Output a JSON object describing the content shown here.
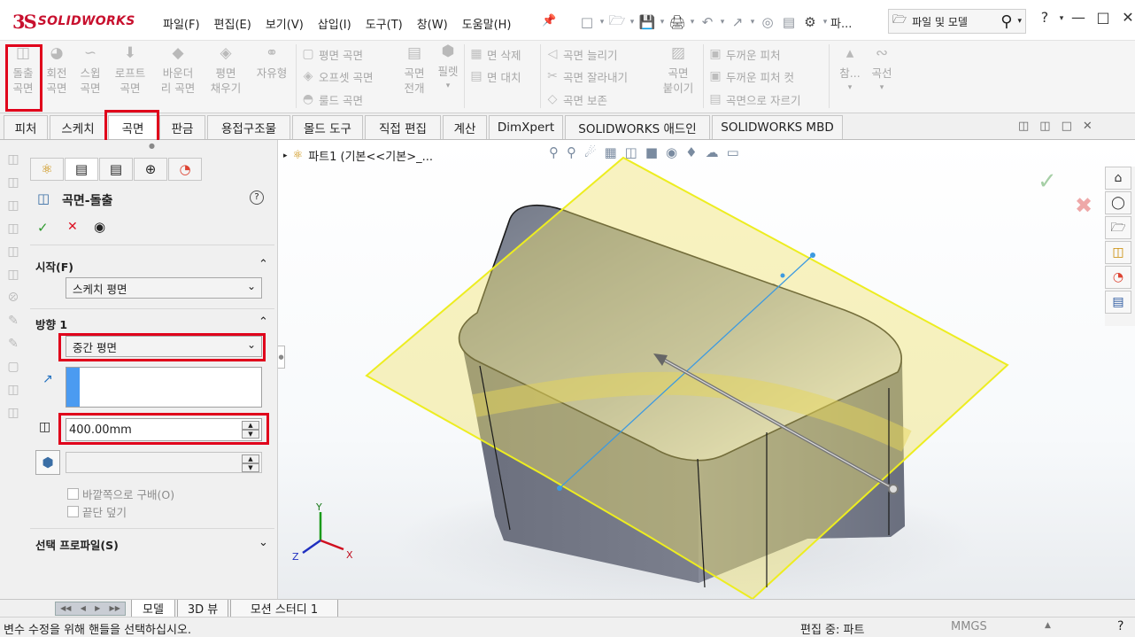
{
  "app": {
    "logo_ds": "3S",
    "logo_name": "SOLIDWORKS"
  },
  "menu": [
    "파일(F)",
    "편집(E)",
    "보기(V)",
    "삽입(I)",
    "도구(T)",
    "창(W)",
    "도움말(H)"
  ],
  "quick_access": {
    "more_label": "파...",
    "search_placeholder": "파일 및 모델"
  },
  "ribbon": {
    "large_buttons": [
      {
        "line1": "돌출",
        "line2": "곡면"
      },
      {
        "line1": "회전",
        "line2": "곡면"
      },
      {
        "line1": "스윕",
        "line2": "곡면"
      },
      {
        "line1": "로프트",
        "line2": "곡면"
      },
      {
        "line1": "바운더",
        "line2": "리 곡면"
      },
      {
        "line1": "평면",
        "line2": "채우기"
      },
      {
        "line1": "자유형",
        "line2": ""
      }
    ],
    "group2": [
      "평면 곡면",
      "오프셋 곡면",
      "룰드 곡면"
    ],
    "surface_expand": {
      "line1": "곡면",
      "line2": "전개"
    },
    "palette": "필렛",
    "group3": [
      "면 삭제",
      "면 대치"
    ],
    "group4": [
      "곡면 늘리기",
      "곡면 잘라내기",
      "곡면 보존"
    ],
    "knit": {
      "line1": "곡면",
      "line2": "붙이기"
    },
    "group5": [
      "두꺼운 피처",
      "두꺼운 피처 컷",
      "곡면으로 자르기"
    ],
    "ref": "참...",
    "curves": "곡선"
  },
  "command_tabs": [
    "피처",
    "스케치",
    "곡면",
    "판금",
    "용접구조물",
    "몰드 도구",
    "직접 편집",
    "계산",
    "DimXpert",
    "SOLIDWORKS 애드인",
    "SOLIDWORKS MBD"
  ],
  "property_manager": {
    "title": "곡면-돌출",
    "from_section": "시작(F)",
    "from_value": "스케치 평면",
    "direction_section": "방향 1",
    "end_condition": "중간 평면",
    "depth": "400.00mm",
    "draft_outward": "바깥쪽으로 구배(O)",
    "cap_end": "끝단 덮기",
    "selected_contours": "선택 프로파일(S)"
  },
  "viewport": {
    "tree_item": "파트1  (기본<<기본>_...",
    "triad": {
      "x": "X",
      "y": "Y",
      "z": "Z"
    }
  },
  "bottom_tabs": [
    "모델",
    "3D 뷰",
    "모션 스터디 1"
  ],
  "status": {
    "message": "변수 수정을 위해 핸들을 선택하십시오.",
    "mode": "편집 중: 파트",
    "units": "MMGS"
  }
}
